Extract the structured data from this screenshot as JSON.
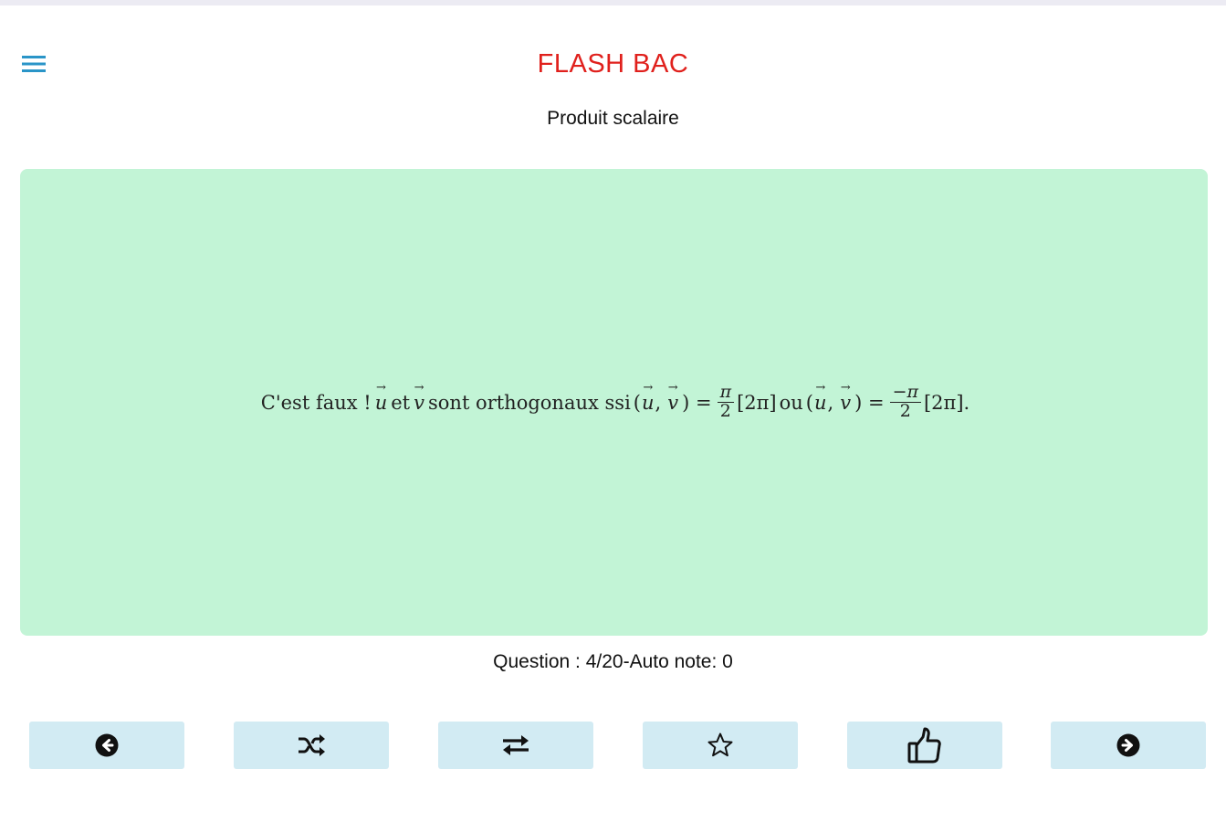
{
  "header": {
    "title": "FLASH BAC",
    "menu_icon": "hamburger-menu-icon",
    "title_color": "#e0201c"
  },
  "subtitle": "Produit scalaire",
  "card": {
    "background": "#c2f4d6",
    "answer": {
      "lead": "C'est faux !",
      "u": "u",
      "v": "v",
      "and": "et",
      "middle": "sont orthogonaux ssi",
      "open": "(",
      "comma": ",",
      "close_eq": ") =",
      "frac1_num": "π",
      "frac1_den": "2",
      "mod1": "[2π]",
      "or": "ou",
      "frac2_num": "−π",
      "frac2_den": "2",
      "mod2": "[2π]."
    }
  },
  "status": "Question : 4/20-Auto note: 0",
  "toolbar": {
    "button_color": "#d2ebf3",
    "buttons": [
      {
        "name": "previous",
        "icon": "arrow-left-circle-icon"
      },
      {
        "name": "shuffle",
        "icon": "shuffle-icon"
      },
      {
        "name": "flip",
        "icon": "exchange-arrows-icon"
      },
      {
        "name": "favorite",
        "icon": "star-outline-icon"
      },
      {
        "name": "like",
        "icon": "thumbs-up-icon"
      },
      {
        "name": "next",
        "icon": "arrow-right-circle-icon"
      }
    ]
  }
}
